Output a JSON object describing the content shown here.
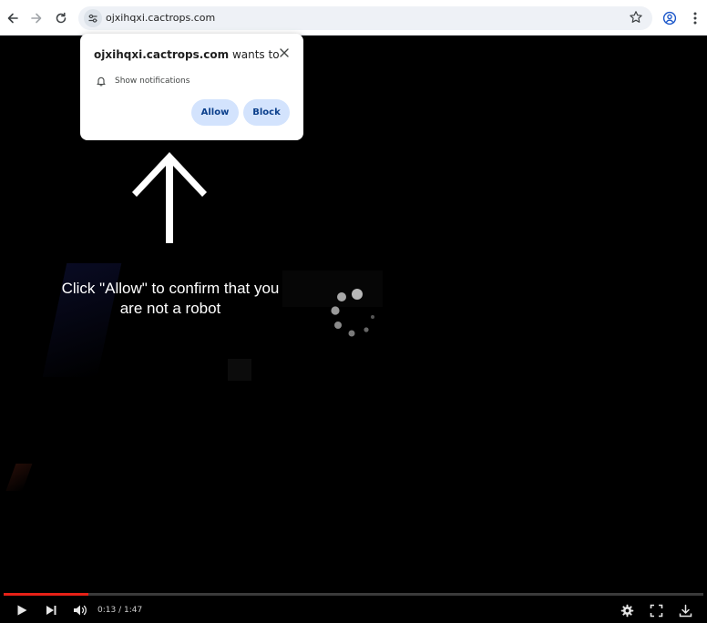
{
  "browser": {
    "url": "ojxihqxi.cactrops.com"
  },
  "popup": {
    "site": "ojxihqxi.cactrops.com",
    "wants_to": " wants to",
    "permission": "Show notifications",
    "allow_label": "Allow",
    "block_label": "Block"
  },
  "page": {
    "caption_line1": "Click \"Allow\" to confirm that you",
    "caption_line2": "are not a robot"
  },
  "player": {
    "time": "0:13 / 1:47",
    "progress": 0.1215
  },
  "colors": {
    "accent_progress": "#e62117",
    "popup_button_bg": "#d3e3fd",
    "popup_button_text": "#0b3f8c"
  },
  "icons": [
    "back-icon",
    "forward-icon",
    "reload-icon",
    "site-info-icon",
    "star-icon",
    "profile-icon",
    "menu-icon",
    "close-icon",
    "bell-icon",
    "arrow-up-icon",
    "spinner-icon",
    "play-icon",
    "next-icon",
    "volume-icon",
    "settings-icon",
    "fullscreen-icon",
    "download-icon"
  ]
}
